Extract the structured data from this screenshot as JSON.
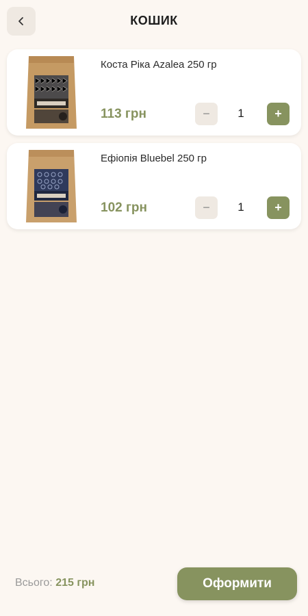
{
  "header": {
    "title": "КОШИК",
    "back_icon": "chevron-left-icon"
  },
  "cart": {
    "items": [
      {
        "name": "Коста Ріка Azalea 250 гр",
        "price": "113 грн",
        "quantity": "1",
        "minus_label": "−",
        "plus_label": "+",
        "image": "coffee-bag-costa-rica"
      },
      {
        "name": "Ефіопія Bluebel 250 гр",
        "price": "102 грн",
        "quantity": "1",
        "minus_label": "−",
        "plus_label": "+",
        "image": "coffee-bag-ethiopia"
      }
    ]
  },
  "footer": {
    "total_label": "Всього:",
    "total_amount": "215 грн",
    "checkout_label": "Оформити"
  },
  "colors": {
    "background": "#fcf7f2",
    "accent": "#87935f",
    "muted_button": "#efe9e2",
    "card": "#ffffff"
  }
}
